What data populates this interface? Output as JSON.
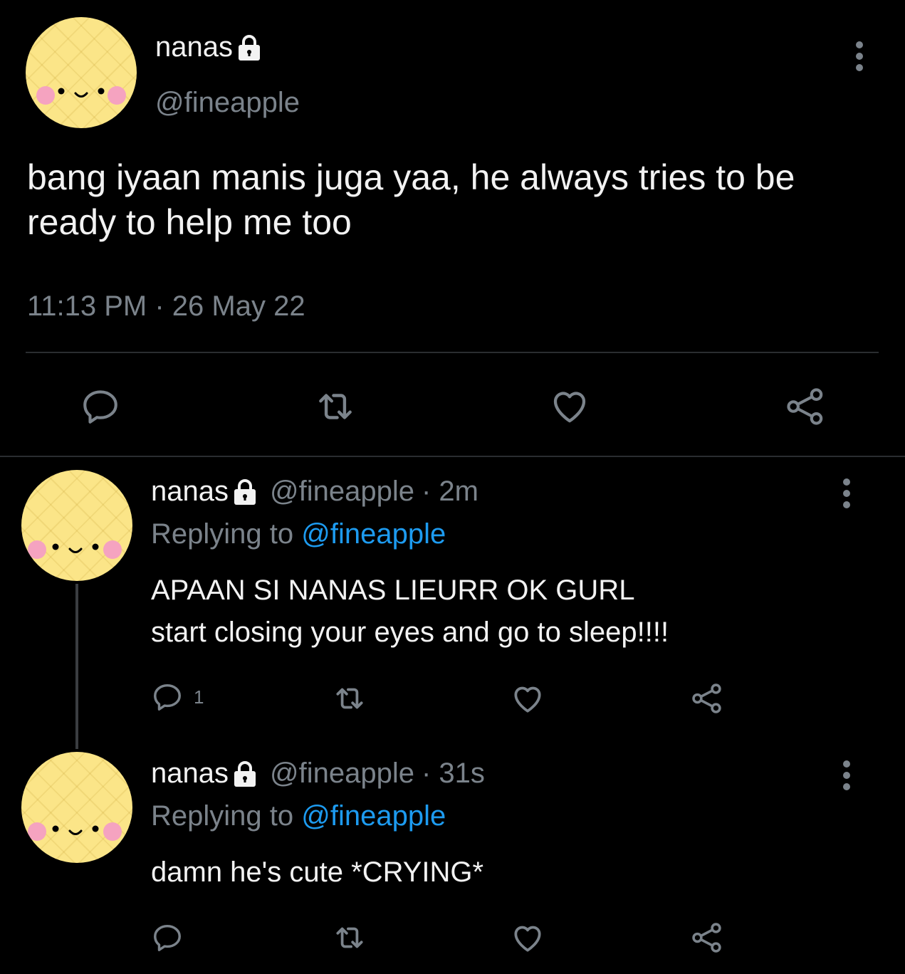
{
  "main_tweet": {
    "name": "nanas",
    "handle": "@fineapple",
    "text": "bang iyaan manis juga yaa, he always tries to be ready to help me too",
    "timestamp": "11:13 PM · 26 May 22",
    "actions": [
      "reply-icon",
      "retweet-icon",
      "like-icon",
      "share-icon"
    ]
  },
  "replies": [
    {
      "name": "nanas",
      "handle": "@fineapple",
      "time": "· 2m",
      "replying_label": "Replying to",
      "replying_to": "@fineapple",
      "text": "APAAN SI NANAS LIEURR OK GURL\nstart closing your eyes and go to sleep!!!!",
      "reply_count": "1"
    },
    {
      "name": "nanas",
      "handle": "@fineapple",
      "time": "· 31s",
      "replying_label": "Replying to",
      "replying_to": "@fineapple",
      "text": "damn he's cute *CRYING*",
      "reply_count": ""
    }
  ],
  "colors": {
    "background": "#000000",
    "text": "#f2f2f2",
    "muted": "#7b838b",
    "link": "#1d9bf0",
    "avatar": "#fbe588"
  }
}
